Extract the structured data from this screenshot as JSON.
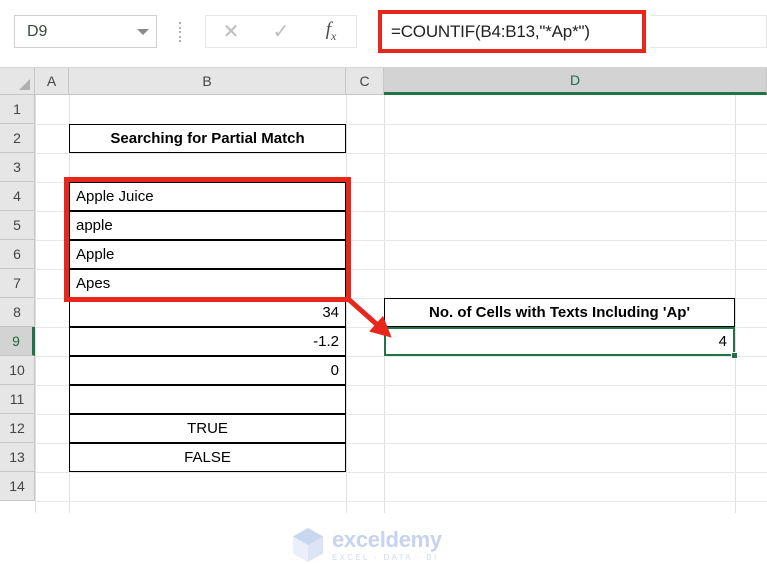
{
  "formula_bar": {
    "name_box_value": "D9",
    "name_box_placeholder": "Name Box",
    "cancel_icon": "cancel-icon",
    "enter_icon": "enter-icon",
    "fx_icon": "fx",
    "fx_sub": "x",
    "formula": "=COUNTIF(B4:B13,\"*Ap*\")",
    "formula_placeholder": "Formula Bar",
    "highlight_color": "#e8271c"
  },
  "grid": {
    "columns": [
      {
        "label": "A",
        "selected": false
      },
      {
        "label": "B",
        "selected": false
      },
      {
        "label": "C",
        "selected": false
      },
      {
        "label": "D",
        "selected": true
      }
    ],
    "rows": [
      {
        "label": "1",
        "selected": false
      },
      {
        "label": "2",
        "selected": false
      },
      {
        "label": "3",
        "selected": false
      },
      {
        "label": "4",
        "selected": false
      },
      {
        "label": "5",
        "selected": false
      },
      {
        "label": "6",
        "selected": false
      },
      {
        "label": "7",
        "selected": false
      },
      {
        "label": "8",
        "selected": false
      },
      {
        "label": "9",
        "selected": true
      },
      {
        "label": "10",
        "selected": false
      },
      {
        "label": "11",
        "selected": false
      },
      {
        "label": "12",
        "selected": false
      },
      {
        "label": "13",
        "selected": false
      },
      {
        "label": "14",
        "selected": false
      }
    ],
    "selection_color": "#217346",
    "cells": {
      "b2": "Searching for Partial Match",
      "b4": "Apple Juice",
      "b5": "apple",
      "b6": "Apple",
      "b7": "Apes",
      "b8": "34",
      "b9": "-1.2",
      "b10": "0",
      "b11": "",
      "b12": "TRUE",
      "b13": "FALSE",
      "d8": "No. of Cells with Texts Including 'Ap'",
      "d9": "4"
    }
  },
  "annotation": {
    "rect_label": "highlight-range-b4-b7",
    "arrow_label": "annotation-arrow",
    "color": "#e8271c"
  },
  "watermark": {
    "name": "exceldemy",
    "tagline": "EXCEL  ·  DATA  ·  BI",
    "logo": "exceldemy-cube-logo"
  }
}
